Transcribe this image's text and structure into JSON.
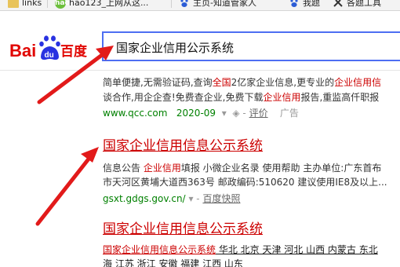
{
  "bookmarks": {
    "links": "links",
    "hao123_label": "hao",
    "hao123": "hao123_上网从这...",
    "zhidao": "主页-知道管家人",
    "wode": "我题",
    "tool": "各题工具"
  },
  "logo": {
    "bai": "Bai",
    "du": "du",
    "baidu_cn": "百度"
  },
  "search": {
    "query": "国家企业信用公示系统"
  },
  "results": [
    {
      "line1": [
        "简单便捷,无需验证码,查询",
        "全国",
        "2亿家企业信息,更专业的",
        "企业信用信"
      ],
      "line2": [
        "谈合作,用企企查!免费查企业,免费下载",
        "企业信用",
        "报告,重监高仟职报"
      ],
      "url": "www.qcc.com",
      "date": "2020-09",
      "eval": "评价",
      "ad": "广告"
    },
    {
      "title": "国家企业信用信息公示系统",
      "line1": [
        "信息公告 ",
        "企业信用",
        "填报 小微企业名录 使用帮助  主办单位:广东首布"
      ],
      "line2": "市天河区黄埔大道西363号 邮政编码:510620 建议使用IE8及以上...",
      "url": "gsxt.gdgs.gov.cn/",
      "snapshot": "百度快照"
    },
    {
      "title": "国家企业信用信息公示系统",
      "line1": [
        "国家企业信用信息公示系统",
        " 华北 北京 天津 河北 山西 内蒙古 东北"
      ],
      "line2": "海 江苏 浙江 安徽 福建 江西 山东"
    }
  ]
}
